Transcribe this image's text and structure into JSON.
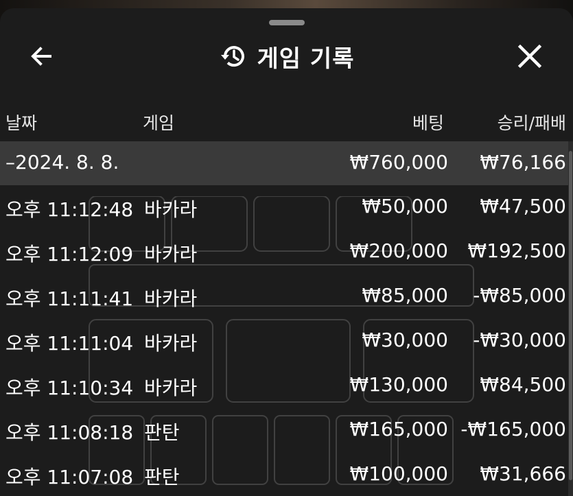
{
  "header": {
    "title": "게임 기록",
    "back_icon": "arrow-left-icon",
    "history_icon": "history-icon",
    "close_icon": "close-icon"
  },
  "columns": {
    "date": "날짜",
    "game": "게임",
    "bet": "베팅",
    "win_loss": "승리/패배"
  },
  "date_group": {
    "label": "–2024. 8. 8.",
    "bet_total": "₩760,000",
    "win_loss_total": "₩76,166"
  },
  "rows": [
    {
      "time": "오후 11:12:48",
      "game": "바카라",
      "bet": "₩50,000",
      "win_loss": "₩47,500"
    },
    {
      "time": "오후 11:12:09",
      "game": "바카라",
      "bet": "₩200,000",
      "win_loss": "₩192,500"
    },
    {
      "time": "오후 11:11:41",
      "game": "바카라",
      "bet": "₩85,000",
      "win_loss": "-₩85,000"
    },
    {
      "time": "오후 11:11:04",
      "game": "바카라",
      "bet": "₩30,000",
      "win_loss": "-₩30,000"
    },
    {
      "time": "오후 11:10:34",
      "game": "바카라",
      "bet": "₩130,000",
      "win_loss": "₩84,500"
    },
    {
      "time": "오후 11:08:18",
      "game": "판탄",
      "bet": "₩165,000",
      "win_loss": "-₩165,000"
    },
    {
      "time": "오후 11:07:08",
      "game": "판탄",
      "bet": "₩100,000",
      "win_loss": "₩31,666"
    }
  ],
  "colors": {
    "panel_bg": "#1c1c1c",
    "date_row_bg": "#3a3a3a",
    "text": "#ffffff"
  }
}
